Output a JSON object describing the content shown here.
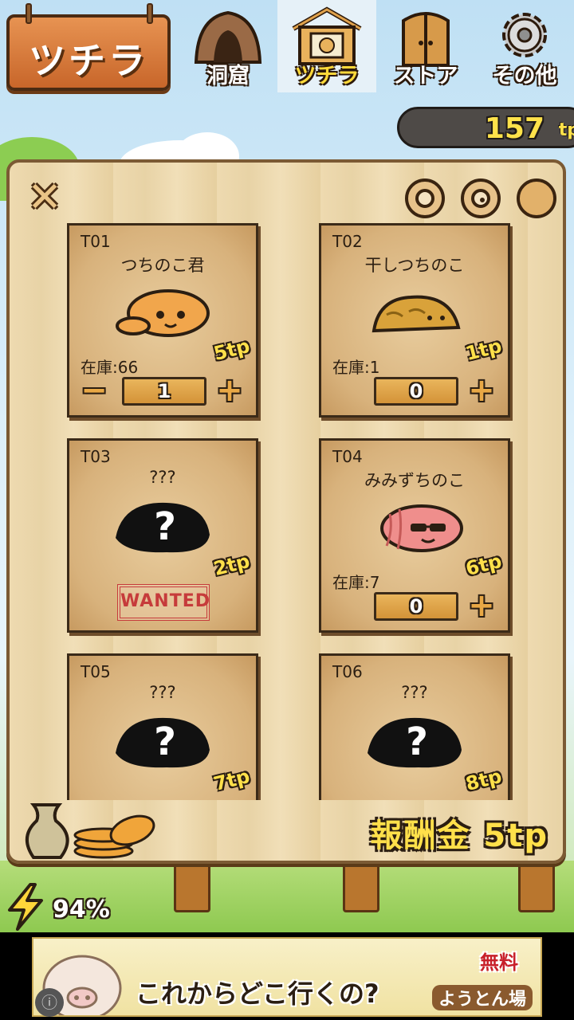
{
  "header": {
    "title": "ツチラ",
    "tabs": [
      {
        "label": "洞窟",
        "icon": "cave-icon",
        "active": false
      },
      {
        "label": "ツチラ",
        "icon": "wanted-board-icon",
        "active": true
      },
      {
        "label": "ストア",
        "icon": "door-icon",
        "active": false
      },
      {
        "label": "その他",
        "icon": "gear-icon",
        "active": false
      }
    ]
  },
  "balance": {
    "value": "157",
    "unit": "tp"
  },
  "panel": {
    "filters": [
      "ring-filter-icon",
      "double-ring-filter-icon",
      "filled-circle-filter-icon"
    ],
    "cards": [
      {
        "id": "T01",
        "name": "つちのこ君",
        "price": "5tp",
        "stock_label": "在庫:66",
        "qty": "1",
        "has_minus": true,
        "has_plus": true,
        "known": true,
        "color": "#f1a64c"
      },
      {
        "id": "T02",
        "name": "干しつちのこ",
        "price": "1tp",
        "stock_label": "在庫:1",
        "qty": "0",
        "has_minus": false,
        "has_plus": true,
        "known": true,
        "color": "#d9a23a"
      },
      {
        "id": "T03",
        "name": "???",
        "price": "2tp",
        "stock_label": "",
        "qty": "",
        "wanted": "WANTED",
        "known": false
      },
      {
        "id": "T04",
        "name": "みみずちのこ",
        "price": "6tp",
        "stock_label": "在庫:7",
        "qty": "0",
        "has_minus": false,
        "has_plus": true,
        "known": true,
        "color": "#ef8e8c"
      },
      {
        "id": "T05",
        "name": "???",
        "price": "7tp",
        "known": false
      },
      {
        "id": "T06",
        "name": "???",
        "price": "8tp",
        "known": false
      }
    ],
    "reward_label": "報酬金 5tp"
  },
  "battery": {
    "percent": "94%"
  },
  "ad": {
    "text": "これからどこ行くの?",
    "badge": "無料",
    "brand": "ようとん場"
  },
  "colors": {
    "accent_yellow": "#ffe04a",
    "wood": "#e8d3a6",
    "dark_outline": "#2b1e12"
  }
}
